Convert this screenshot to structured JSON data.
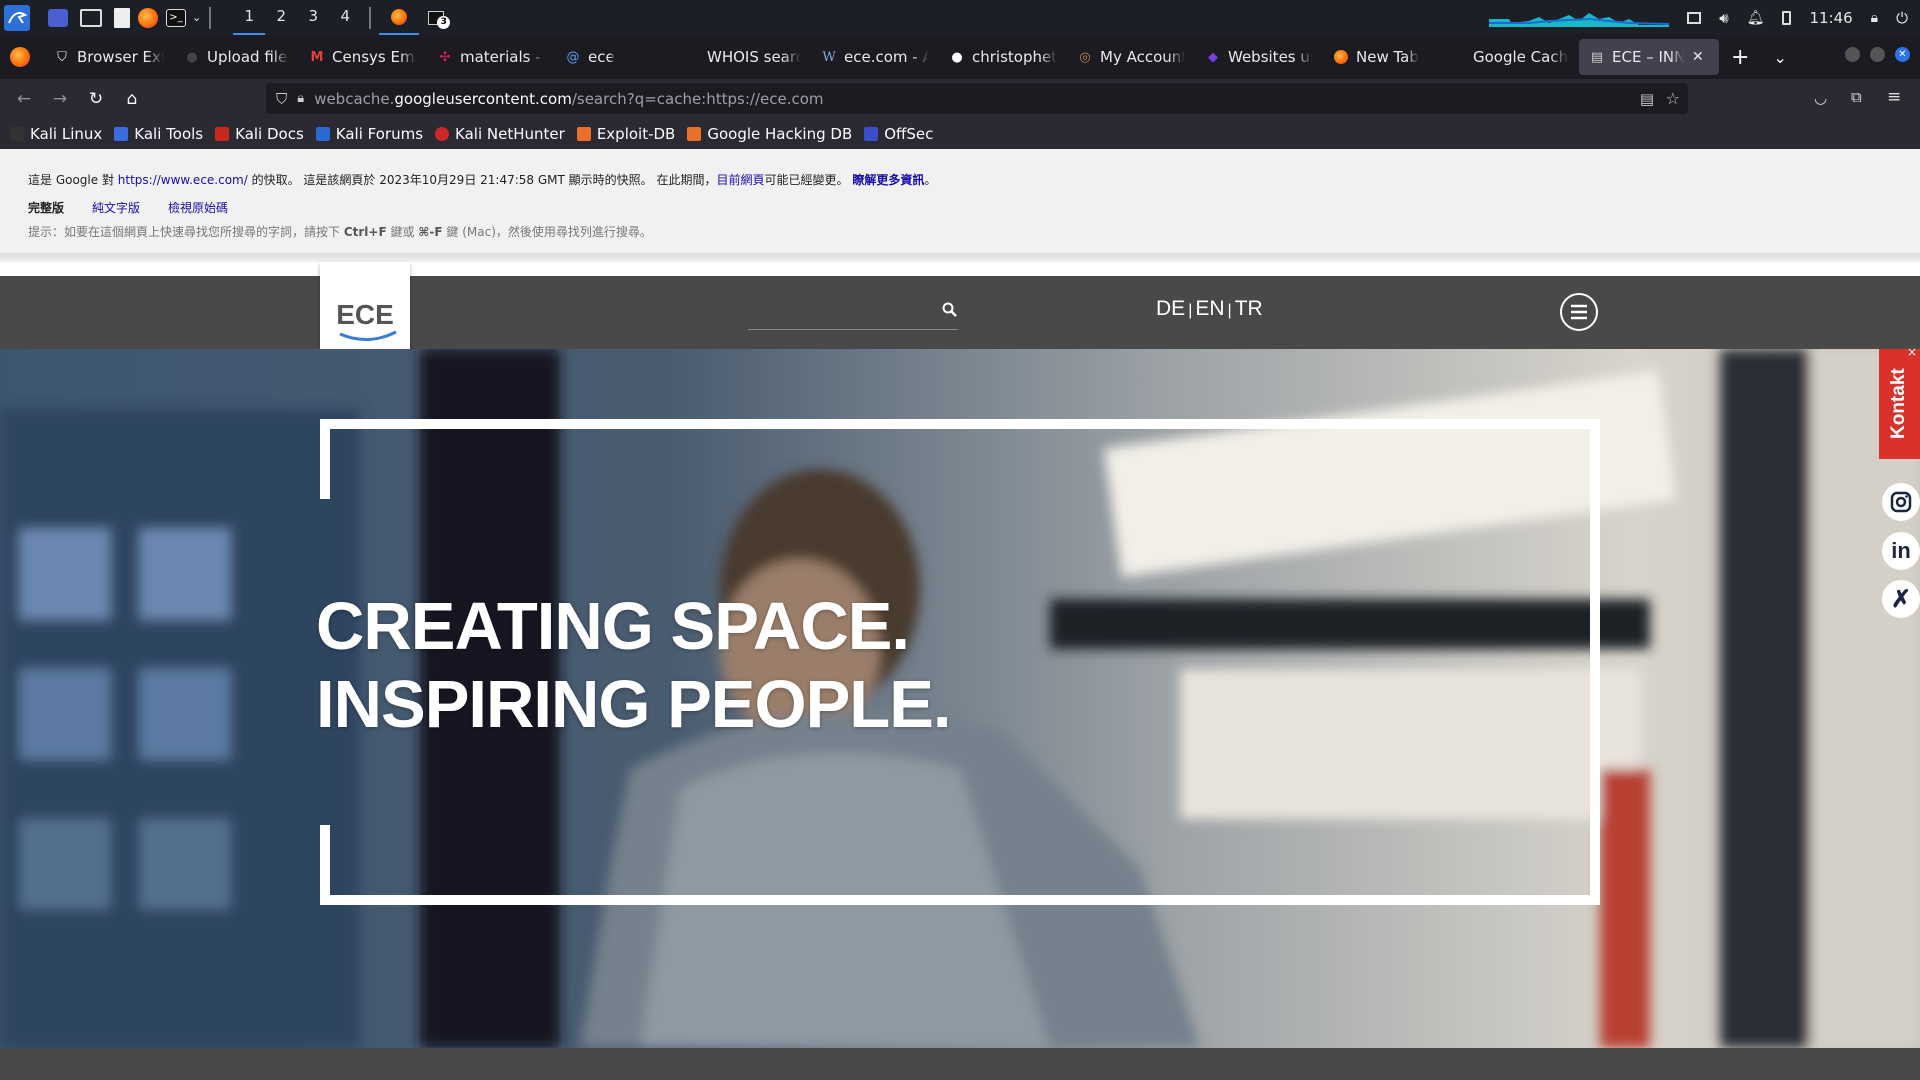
{
  "taskbar": {
    "workspaces": [
      "1",
      "2",
      "3",
      "4"
    ],
    "active_workspace": "1",
    "terminal_badge": "3",
    "clock": "11:46"
  },
  "tabs": [
    {
      "label": "Browser Exte",
      "icon": "shield-icon"
    },
    {
      "label": "Upload files",
      "icon": "github-icon"
    },
    {
      "label": "Censys Email",
      "icon": "gmail-icon"
    },
    {
      "label": "materials - N",
      "icon": "slack-icon"
    },
    {
      "label": "ece",
      "icon": "at-icon"
    },
    {
      "label": "WHOIS search r",
      "icon": "none"
    },
    {
      "label": "ece.com - Ar",
      "icon": "wikipedia-icon"
    },
    {
      "label": "christophetd/",
      "icon": "github-icon"
    },
    {
      "label": "My Account -",
      "icon": "account-icon"
    },
    {
      "label": "Websites usi",
      "icon": "diamond-icon"
    },
    {
      "label": "New Tab",
      "icon": "firefox-icon"
    },
    {
      "label": "Google Cached",
      "icon": "none"
    },
    {
      "label": "ECE – INN",
      "icon": "page-icon",
      "active": true
    }
  ],
  "url": {
    "prefix": "webcache.",
    "domain": "googleusercontent.com",
    "path": "/search?q=cache:https://ece.com"
  },
  "bookmarks": [
    "Kali Linux",
    "Kali Tools",
    "Kali Docs",
    "Kali Forums",
    "Kali NetHunter",
    "Exploit-DB",
    "Google Hacking DB",
    "OffSec"
  ],
  "cache_notice": {
    "t1": "這是 Google 對 ",
    "link1": "https://www.ece.com/",
    "t2": " 的快取。 這是該網頁於 2023年10月29日 21:47:58 GMT 顯示時的快照。 在此期間，",
    "link2": "目前網頁",
    "t3": "可能已經變更。 ",
    "link3": "瞭解更多資訊",
    "t4": "。",
    "full_version": "完整版",
    "text_only": "純文字版",
    "view_source": "檢視原始碼",
    "tip_prefix": "提示：如要在這個網頁上快速尋找您所搜尋的字詞，請按下 ",
    "tip_key1": "Ctrl+F",
    "tip_mid": " 鍵或 ",
    "tip_key2": "⌘-F",
    "tip_suffix": " 鍵 (Mac)，然後使用尋找列進行搜尋。"
  },
  "site": {
    "logo": "ECE",
    "lang_de": "DE",
    "lang_en": "EN",
    "lang_tr": "TR",
    "pipe": "|",
    "headline_1": "CREATING SPACE.",
    "headline_2": "INSPIRING PEOPLE.",
    "kontakt": "Kontakt",
    "kontakt_close": "×"
  }
}
